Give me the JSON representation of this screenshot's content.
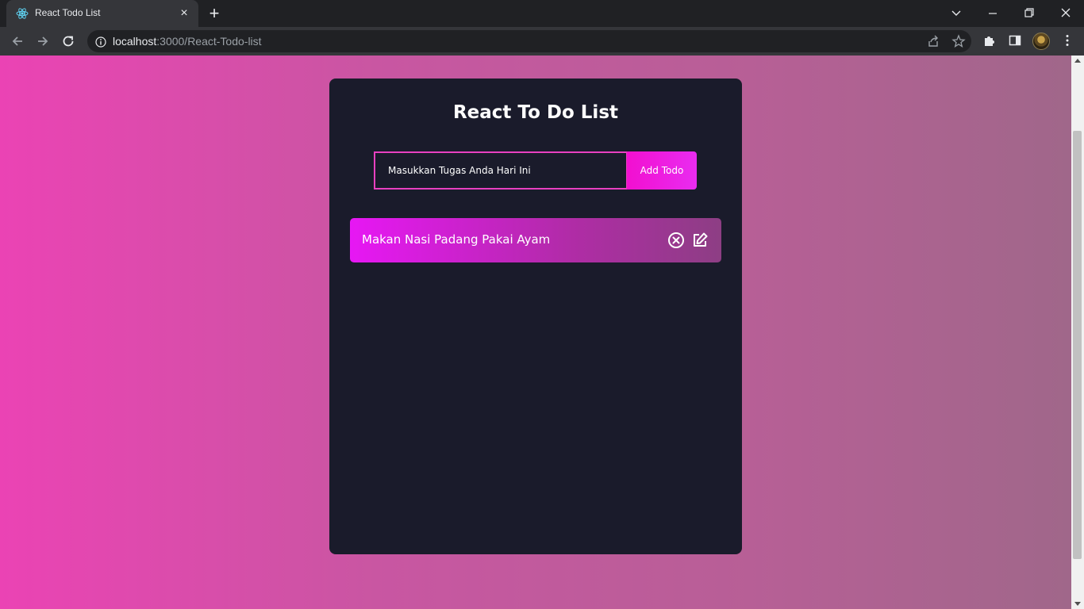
{
  "browser": {
    "tab_title": "React Todo List",
    "tab_close": "×",
    "new_tab": "+",
    "url_host": "localhost",
    "url_path": ":3000/React-Todo-list"
  },
  "app": {
    "title": "React To Do List",
    "input_placeholder": "Masukkan Tugas Anda Hari Ini",
    "input_value": "",
    "add_button_label": "Add Todo",
    "todos": [
      {
        "task": "Makan Nasi Padang Pakai Ayam",
        "completed": false
      }
    ]
  },
  "colors": {
    "card_bg": "#1a1b2b",
    "accent": "#e840c0",
    "button": "#f20fd0",
    "page_gradient_start": "#eb43b4",
    "page_gradient_end": "#a0678a"
  },
  "icons": {
    "tab_favicon": "react-icon",
    "delete": "circle-x-icon",
    "edit": "edit-icon"
  }
}
